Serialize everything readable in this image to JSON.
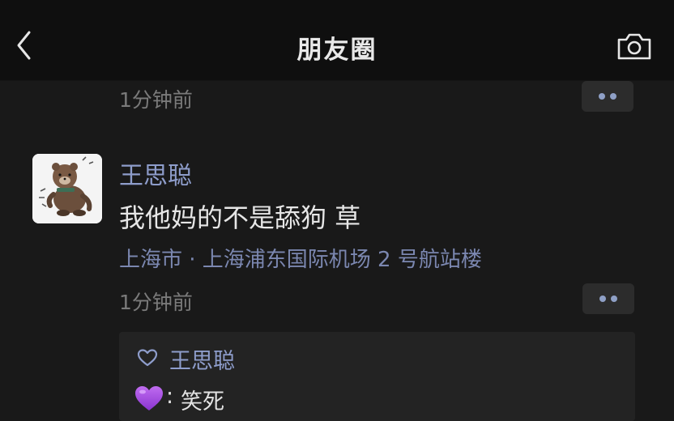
{
  "header": {
    "title": "朋友圈",
    "back_icon": "chevron-left-icon",
    "camera_icon": "camera-icon"
  },
  "previous_post": {
    "time": "1分钟前"
  },
  "post": {
    "username": "王思聪",
    "text": "我他妈的不是舔狗 草",
    "location": "上海市 · 上海浦东国际机场 2 号航站楼",
    "time": "1分钟前",
    "avatar_icon": "bear-sticker-avatar"
  },
  "interactions": {
    "likes": [
      "王思聪"
    ],
    "like_icon": "heart-outline-icon",
    "comments": [
      {
        "author_icon": "purple-heart-emoji",
        "separator": ":",
        "text": "笑死"
      }
    ]
  },
  "colors": {
    "background": "#191919",
    "header": "#0f0f0f",
    "name_link": "#8e9dcb",
    "location_link": "#7b87b0",
    "muted": "#7a7a7a",
    "panel": "#232323",
    "purple_heart": "#a24ee0"
  }
}
